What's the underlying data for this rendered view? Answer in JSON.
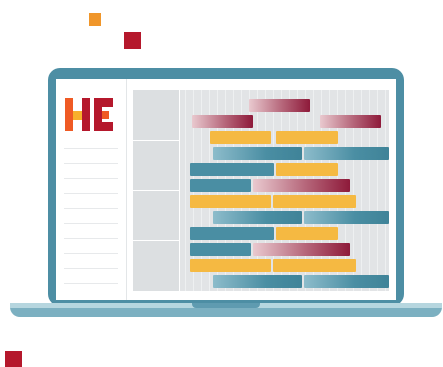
{
  "decor": {
    "squares": [
      {
        "name": "orange-square",
        "color": "#f0962a"
      },
      {
        "name": "red-square-top",
        "color": "#b5182c"
      },
      {
        "name": "red-square-bottom",
        "color": "#b5182c"
      }
    ]
  },
  "colors": {
    "frame": "#4d8ea4",
    "base": "#7cb0c1",
    "logo_red": "#b5182c",
    "logo_orange": "#ef5a24",
    "logo_yellow": "#f7b02c",
    "bar_blue": "#4a8ea3",
    "bar_gold": "#f5b942",
    "bar_maroon": "#8e1a3a"
  },
  "logo": {
    "icon": "hc-logo-icon"
  },
  "gantt": {
    "rows": 12,
    "series": [
      {
        "kind": "maroon-gradient",
        "row": 0
      },
      {
        "kind": "maroon-gradient",
        "row": 1
      },
      {
        "kind": "maroon-gradient",
        "row": 1
      },
      {
        "kind": "gold",
        "row": 2
      },
      {
        "kind": "gold",
        "row": 2
      },
      {
        "kind": "blue-gradient",
        "row": 3
      },
      {
        "kind": "blue-gradient",
        "row": 3
      },
      {
        "kind": "blue",
        "row": 4
      },
      {
        "kind": "gold",
        "row": 4
      },
      {
        "kind": "blue",
        "row": 5
      },
      {
        "kind": "maroon-gradient",
        "row": 5
      },
      {
        "kind": "gold",
        "row": 6
      },
      {
        "kind": "gold",
        "row": 6
      },
      {
        "kind": "blue-gradient",
        "row": 7
      },
      {
        "kind": "blue-gradient",
        "row": 7
      },
      {
        "kind": "blue",
        "row": 8
      },
      {
        "kind": "gold",
        "row": 8
      },
      {
        "kind": "blue",
        "row": 9
      },
      {
        "kind": "maroon-gradient",
        "row": 9
      },
      {
        "kind": "gold",
        "row": 10
      },
      {
        "kind": "gold",
        "row": 10
      },
      {
        "kind": "blue-gradient",
        "row": 11
      },
      {
        "kind": "blue-gradient",
        "row": 11
      }
    ]
  }
}
